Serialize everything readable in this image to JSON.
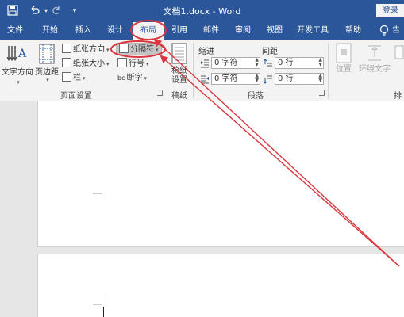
{
  "window": {
    "title": "文档1.docx  -  Word",
    "login_label": "登录"
  },
  "qat": {
    "save_icon": "save-icon",
    "undo_icon": "undo-icon",
    "redo_icon": "redo-icon",
    "customize_icon": "customize-icon"
  },
  "tabs": [
    {
      "label": "文件"
    },
    {
      "label": "开始"
    },
    {
      "label": "插入"
    },
    {
      "label": "设计"
    },
    {
      "label": "布局"
    },
    {
      "label": "引用"
    },
    {
      "label": "邮件"
    },
    {
      "label": "审阅"
    },
    {
      "label": "视图"
    },
    {
      "label": "开发工具"
    },
    {
      "label": "帮助"
    }
  ],
  "active_tab": "布局",
  "tell_me": {
    "label": "告"
  },
  "ribbon": {
    "page_setup": {
      "text_direction": "文字方向",
      "margins": "页边距",
      "orientation": "纸张方向",
      "size": "纸张大小",
      "columns": "栏",
      "breaks": "分隔符",
      "line_numbers": "行号",
      "hyphenation": "断字",
      "group_label": "页面设置"
    },
    "manuscript": {
      "button_line1": "稿纸",
      "button_line2": "设置",
      "group_label": "稿纸"
    },
    "paragraph": {
      "indent_header": "缩进",
      "spacing_header": "间距",
      "indent_left": "0 字符",
      "indent_right": "0 字符",
      "spacing_before": "0 行",
      "spacing_after": "0 行",
      "group_label": "段落"
    },
    "arrange": {
      "position": "位置",
      "wrap_text": "环绕文字",
      "group_label": "排"
    }
  },
  "colors": {
    "word_blue": "#2b579a",
    "annotation_red": "#d9363e"
  }
}
